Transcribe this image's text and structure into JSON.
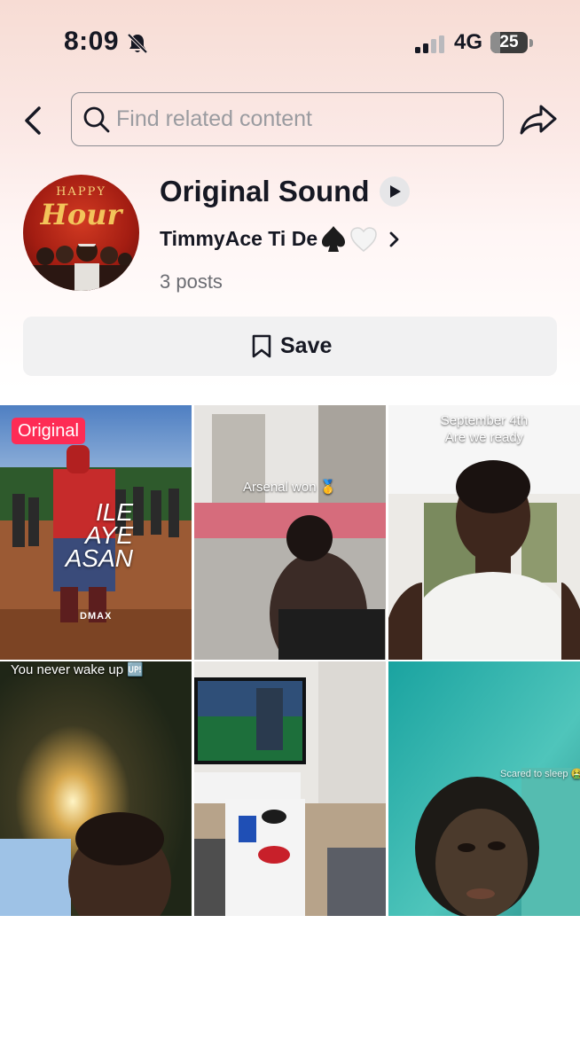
{
  "status_bar": {
    "time": "8:09",
    "network": "4G",
    "battery": "25",
    "battery_level": 0.25
  },
  "search": {
    "placeholder": "Find related content"
  },
  "sound": {
    "title": "Original Sound",
    "author": "TimmyAce Ti De",
    "author_emoji_icons": [
      "spade-icon",
      "white-heart-icon"
    ],
    "post_count": "3 posts",
    "cover_text_line1": "HAPPY",
    "cover_text_line2": "Hour"
  },
  "actions": {
    "save_label": "Save"
  },
  "videos": [
    {
      "badge": "Original",
      "overlay_lines": [
        "ILE",
        "AYE",
        "ASAN"
      ],
      "watermark": "DMAX"
    },
    {
      "caption": "Arsenal won 🥇"
    },
    {
      "caption_line1": "September 4th",
      "caption_line2": "Are we ready"
    },
    {
      "caption": "You never wake up 🆙"
    },
    {
      "caption": ""
    },
    {
      "caption": "Scared to sleep 🤮"
    }
  ],
  "colors": {
    "accent": "#fe2c55",
    "text": "#161823",
    "muted": "#6b6c72",
    "button_bg": "#f1f1f2"
  }
}
